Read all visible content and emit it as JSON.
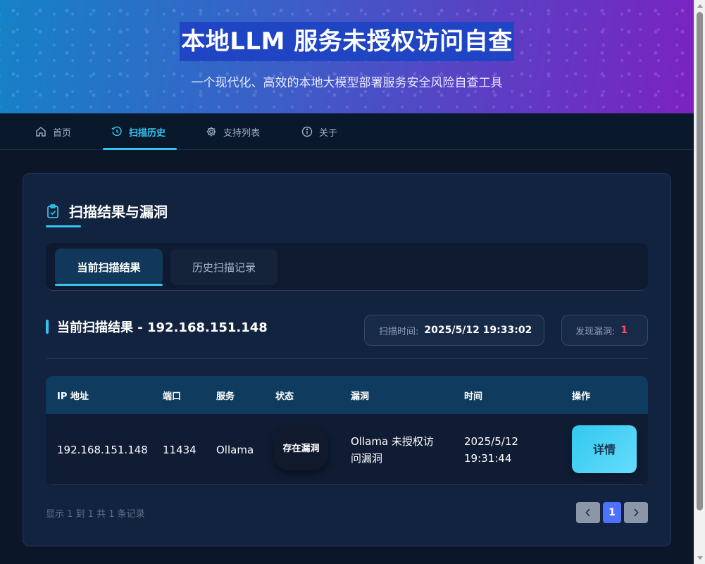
{
  "header": {
    "title": "本地LLM 服务未授权访问自查",
    "subtitle": "一个现代化、高效的本地大模型部署服务安全风险自查工具"
  },
  "nav": {
    "items": [
      {
        "label": "首页",
        "icon": "home-icon"
      },
      {
        "label": "扫描历史",
        "icon": "history-icon",
        "active": true
      },
      {
        "label": "支持列表",
        "icon": "gear-icon"
      },
      {
        "label": "关于",
        "icon": "info-icon"
      }
    ]
  },
  "section": {
    "title": "扫描结果与漏洞",
    "icon": "clipboard-check-icon"
  },
  "tabs": [
    {
      "label": "当前扫描结果",
      "active": true
    },
    {
      "label": "历史扫描记录",
      "active": false
    }
  ],
  "result": {
    "title": "当前扫描结果 - 192.168.151.148",
    "scan_time_label": "扫描时间:",
    "scan_time_value": "2025/5/12 19:33:02",
    "vuln_label": "发现漏洞:",
    "vuln_value": "1"
  },
  "table": {
    "headers": [
      "IP 地址",
      "端口",
      "服务",
      "状态",
      "漏洞",
      "时间",
      "操作"
    ],
    "rows": [
      {
        "ip": "192.168.151.148",
        "port": "11434",
        "service": "Ollama",
        "status": "存在漏洞",
        "vuln": "Ollama 未授权访问漏洞",
        "time": "2025/5/12 19:31:44",
        "action": "详情"
      }
    ]
  },
  "pagination": {
    "info": "显示 1 到 1 共 1 条记录",
    "current_page": "1"
  },
  "colors": {
    "accent": "#35c4ee",
    "danger": "#ff4d5e",
    "page_active": "#4f71ff"
  }
}
